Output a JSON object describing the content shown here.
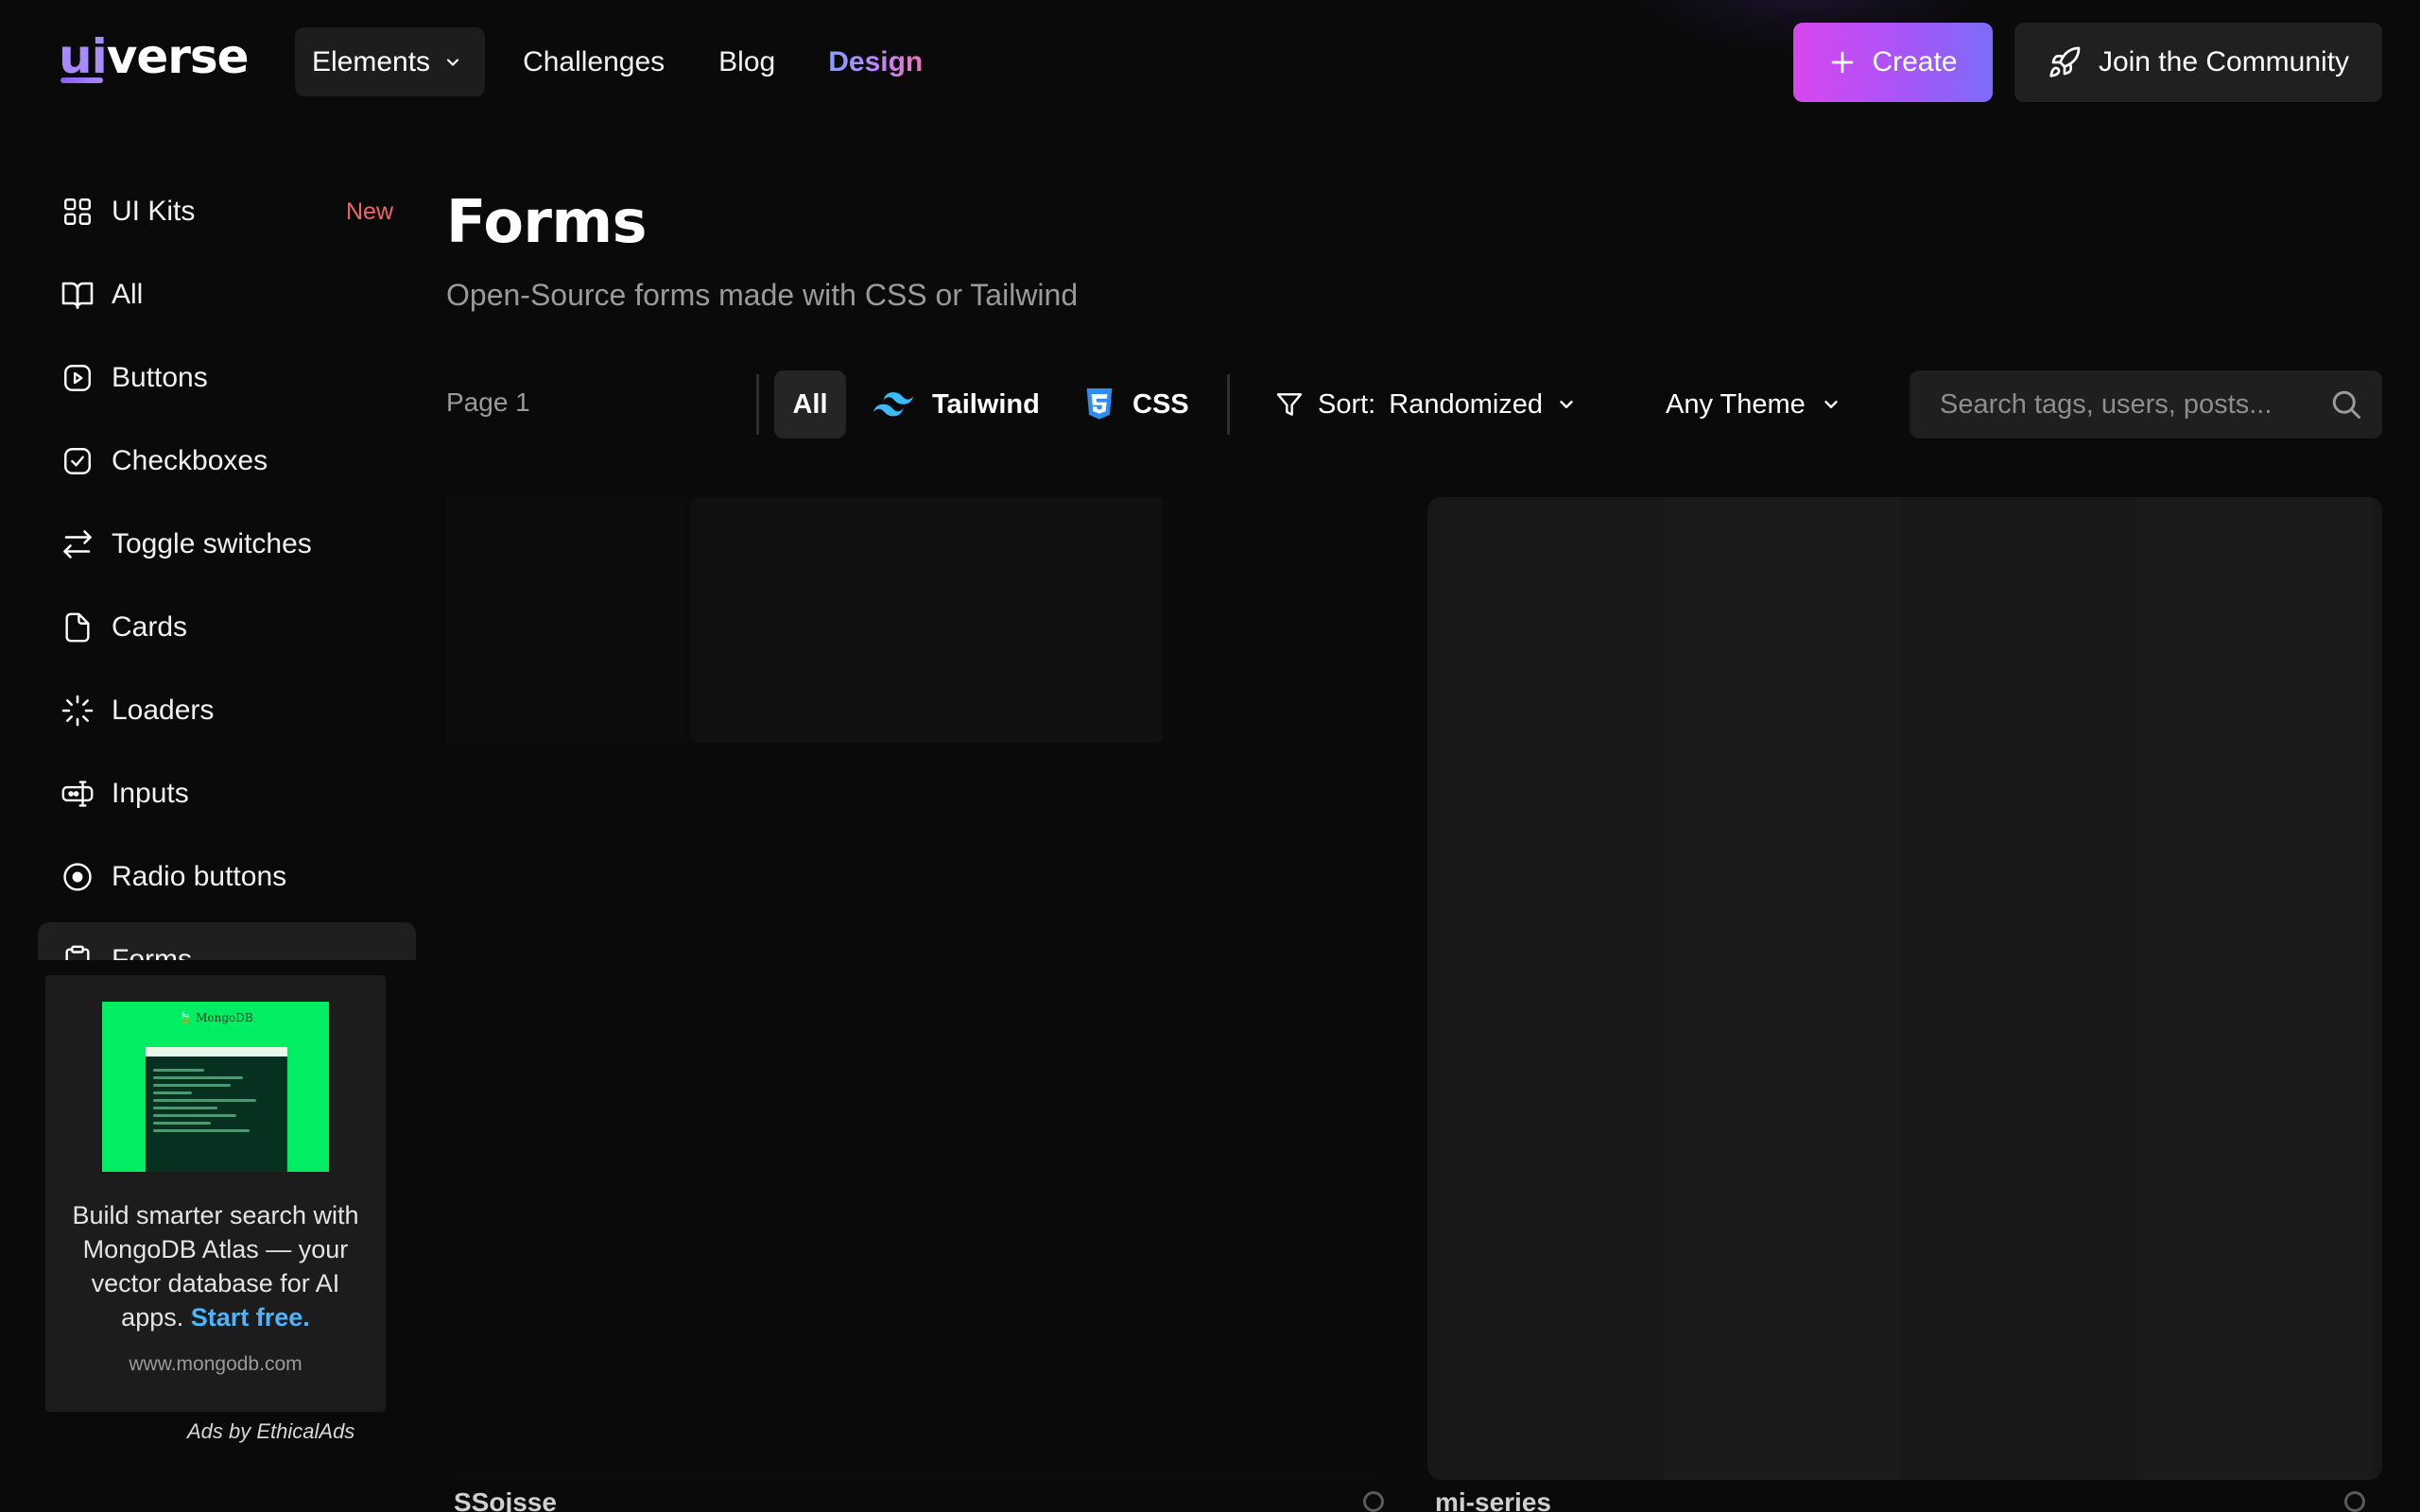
{
  "header": {
    "logo_ui": "ui",
    "logo_verse": "verse",
    "nav_dropdown": "Elements",
    "nav_links": [
      "Challenges",
      "Blog"
    ],
    "nav_design": "Design",
    "create_label": "Create",
    "join_label": "Join the Community"
  },
  "sidebar": {
    "items": [
      {
        "label": "UI Kits",
        "badge": "New",
        "icon": "grid-icon"
      },
      {
        "label": "All",
        "icon": "book-icon"
      },
      {
        "label": "Buttons",
        "icon": "play-square-icon"
      },
      {
        "label": "Checkboxes",
        "icon": "check-square-icon"
      },
      {
        "label": "Toggle switches",
        "icon": "arrows-swap-icon"
      },
      {
        "label": "Cards",
        "icon": "file-icon"
      },
      {
        "label": "Loaders",
        "icon": "loader-icon"
      },
      {
        "label": "Inputs",
        "icon": "input-icon"
      },
      {
        "label": "Radio buttons",
        "icon": "radio-icon"
      },
      {
        "label": "Forms",
        "icon": "clipboard-icon",
        "active": true
      }
    ]
  },
  "ad": {
    "image_brand": "MongoDB",
    "text": "Build smarter search with MongoDB Atlas — your vector database for AI apps.",
    "cta": "Start free.",
    "url": "www.mongodb.com",
    "ads_by": "Ads by EthicalAds"
  },
  "main": {
    "title": "Forms",
    "subtitle": "Open-Source forms made with CSS or Tailwind",
    "page": "Page 1",
    "filters": {
      "all": "All",
      "tailwind": "Tailwind",
      "css": "CSS"
    },
    "sort_label": "Sort:",
    "sort_value": "Randomized",
    "theme": "Any Theme",
    "search_placeholder": "Search tags, users, posts..."
  },
  "cards": [
    {
      "author": "SSojsse"
    },
    {
      "author": "mi-series"
    }
  ],
  "colors": {
    "background": "#0a0a0a",
    "accent_start": "#d946ef",
    "accent_end": "#7c6cf7",
    "badge_new": "#f06565",
    "link_blue": "#4db5ff",
    "tailwind": "#38bdf8",
    "css": "#2d8cf0"
  }
}
